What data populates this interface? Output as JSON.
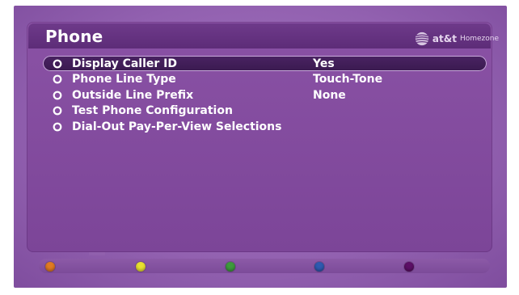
{
  "page": {
    "title": "Phone"
  },
  "brand": {
    "name": "at&t",
    "subtitle": "Homezone",
    "icon": "att-globe-icon"
  },
  "menu": {
    "items": [
      {
        "label": "Display Caller ID",
        "value": "Yes",
        "selected": true,
        "icon": "bullet-icon"
      },
      {
        "label": "Phone Line Type",
        "value": "Touch-Tone",
        "selected": false,
        "icon": "bullet-icon"
      },
      {
        "label": "Outside Line Prefix",
        "value": "None",
        "selected": false,
        "icon": "bullet-icon"
      },
      {
        "label": "Test Phone Configuration",
        "value": "",
        "selected": false,
        "icon": "bullet-icon"
      },
      {
        "label": "Dial-Out Pay-Per-View Selections",
        "value": "",
        "selected": false,
        "icon": "bullet-icon"
      }
    ]
  },
  "footer": {
    "color_buttons": [
      {
        "name": "orange",
        "color": "#e07a22"
      },
      {
        "name": "yellow",
        "color": "#e8e030"
      },
      {
        "name": "green",
        "color": "#3e9a3c"
      },
      {
        "name": "blue",
        "color": "#2e5ab0"
      },
      {
        "name": "purple",
        "color": "#5c0f66"
      }
    ]
  },
  "colors": {
    "background": "#9261b0",
    "panel": "#7c4598",
    "highlight": "#3a1a50",
    "text": "#ffffff"
  }
}
